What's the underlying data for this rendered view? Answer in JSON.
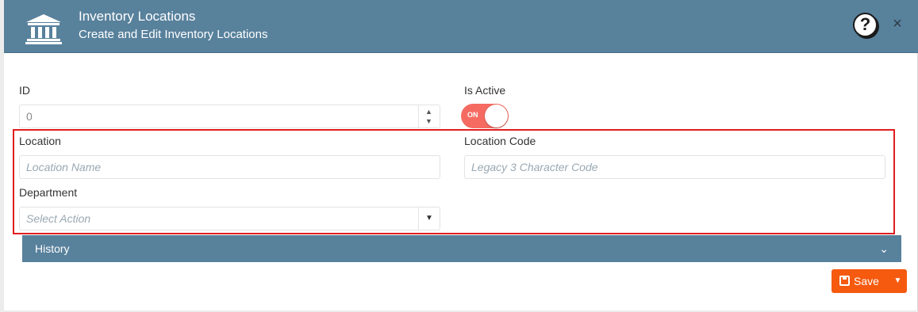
{
  "header": {
    "title": "Inventory Locations",
    "subtitle": "Create and Edit Inventory Locations",
    "logo_icon": "building-columns-icon",
    "help_label": "?",
    "close_label": "×"
  },
  "form": {
    "id": {
      "label": "ID",
      "value": "0"
    },
    "is_active": {
      "label": "Is Active",
      "toggle_text": "ON",
      "checked": true
    },
    "location": {
      "label": "Location",
      "placeholder": "Location Name"
    },
    "location_code": {
      "label": "Location Code",
      "placeholder": "Legacy 3 Character Code"
    },
    "department": {
      "label": "Department",
      "placeholder": "Select Action"
    }
  },
  "history": {
    "label": "History"
  },
  "actions": {
    "save_label": "Save"
  },
  "colors": {
    "header_bg": "#58819c",
    "toggle_on": "#f56b62",
    "save_bg": "#f55a0f",
    "highlight_border": "#e11d1d"
  }
}
